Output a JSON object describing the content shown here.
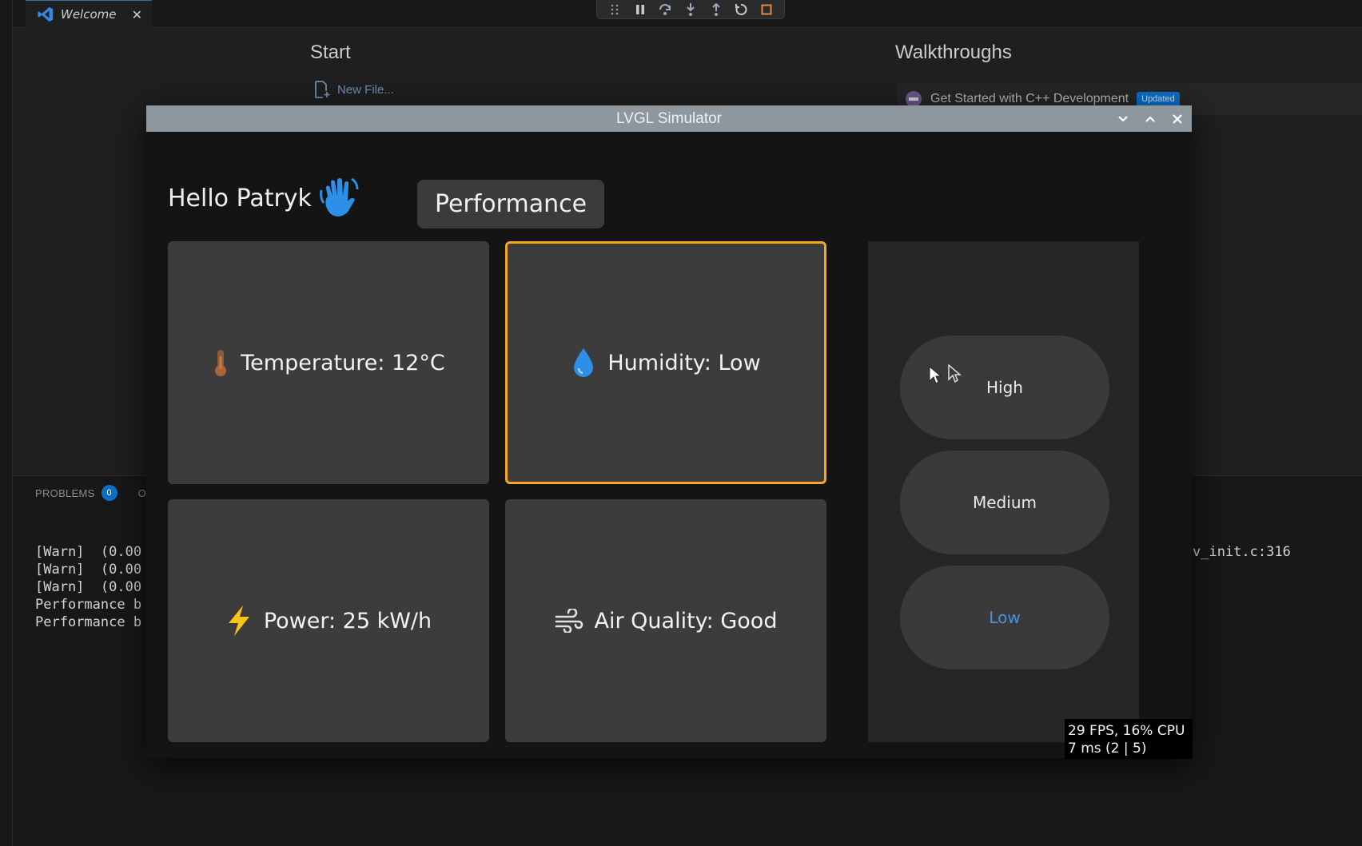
{
  "vscode": {
    "tab": {
      "title": "Welcome",
      "close": "✕"
    },
    "welcome": {
      "start_heading": "Start",
      "new_file": "New File...",
      "walkthroughs_heading": "Walkthroughs",
      "walkthrough_item": "Get Started with C++ Development",
      "walkthrough_badge": "Updated"
    },
    "panel": {
      "problems_label": "PROBLEMS",
      "problems_count": "0",
      "second_tab": "O",
      "terminal_lines": [
        "[Warn]  (0.00",
        "[Warn]  (0.00",
        "[Warn]  (0.00",
        "Performance b",
        "Performance b"
      ],
      "terminal_right": "v_init.c:316"
    }
  },
  "simulator": {
    "title": "LVGL Simulator",
    "greeting": "Hello Patryk",
    "performance_button": "Performance",
    "cards": {
      "temperature": "Temperature: 12°C",
      "humidity": "Humidity: Low",
      "power": "Power: 25 kW/h",
      "air_quality": "Air Quality: Good"
    },
    "levels": {
      "high": "High",
      "medium": "Medium",
      "low": "Low"
    },
    "fps_line1": "29 FPS, 16% CPU",
    "fps_line2": "7 ms (2 | 5)",
    "colors": {
      "accent_border": "#f5a623",
      "low_text": "#4a90d9",
      "card_bg": "#3c3c3c"
    },
    "icons": [
      "thermometer-icon",
      "water-drop-icon",
      "lightning-icon",
      "wind-icon",
      "waving-hand-icon"
    ]
  }
}
